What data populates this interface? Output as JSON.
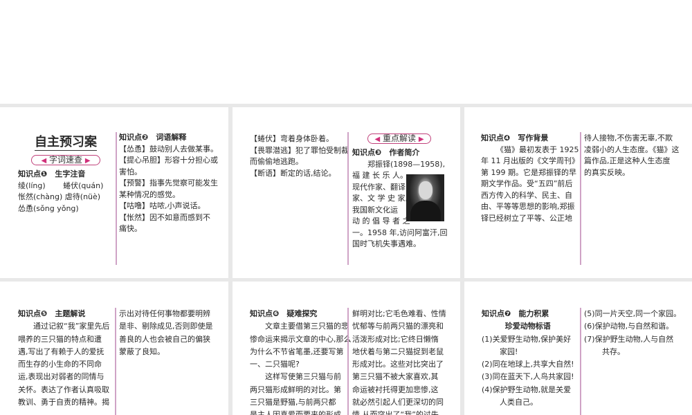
{
  "slides": [
    {
      "title": "自主预习案",
      "badge": "字词速查",
      "left": [
        {
          "t": "知识点❶　生字注音",
          "k": "h"
        },
        {
          "t": "绫(líng)　　 蜷伏(quán)"
        },
        {
          "t": "怅然(chàng)  虐待(nüè)"
        },
        {
          "t": "怂恿(sǒng yǒng)"
        }
      ],
      "right": [
        {
          "t": "知识点❷　词语解释",
          "k": "h"
        },
        {
          "t": "【怂恿】鼓动别人去做某事。"
        },
        {
          "t": "【提心吊胆】形容十分担心或"
        },
        {
          "t": "害怕。"
        },
        {
          "t": "【预警】指事先觉察可能发生"
        },
        {
          "t": "某种情况的感觉。"
        },
        {
          "t": "【咕噜】咕哝,小声说话。"
        },
        {
          "t": "【怅然】因不如意而感到不"
        },
        {
          "t": "痛快。"
        }
      ]
    },
    {
      "badge": "重点解读",
      "left": [
        {
          "t": "【蜷伏】弯着身体卧着。"
        },
        {
          "t": "【畏罪潜逃】犯了罪怕受制裁"
        },
        {
          "t": "而偷偷地逃跑。"
        },
        {
          "t": "【断语】断定的话,结论。"
        }
      ],
      "right": [
        {
          "t": "知识点❸　作者简介",
          "k": "h"
        },
        {
          "t": "郑振铎(1898—1958),",
          "k": "ind"
        },
        {
          "t": "福 建 长 乐 人。"
        },
        {
          "t": "现代作家、翻译"
        },
        {
          "t": "家、文 学 史 家,"
        },
        {
          "t": "我国新文化运"
        },
        {
          "t": "动 的 倡 导 者 之"
        },
        {
          "t": "一。1958 年,访问阿富汗,回"
        },
        {
          "t": "国时飞机失事遇难。"
        }
      ]
    },
    {
      "left": [
        {
          "t": "知识点❹　写作背景",
          "k": "h"
        },
        {
          "t": "《猫》最初发表于 1925",
          "k": "ind"
        },
        {
          "t": "年 11 月出版的《文学周刊》"
        },
        {
          "t": "第 199 期。它是郑振铎的早"
        },
        {
          "t": "期文学作品。受“五四”前后"
        },
        {
          "t": "西方传入的科学、民主、自"
        },
        {
          "t": "由、平等等思想的影响,郑振"
        },
        {
          "t": "铎已经树立了平等、公正地"
        }
      ],
      "right": [
        {
          "t": "待人接物,不伤害无辜,不欺"
        },
        {
          "t": "凌弱小的人生态度。《猫》这"
        },
        {
          "t": "篇作品,正是这种人生态度"
        },
        {
          "t": "的真实反映。"
        }
      ]
    },
    {
      "left": [
        {
          "t": "知识点❺　主题解说",
          "k": "h"
        },
        {
          "t": "通过记叙“我”家里先后",
          "k": "ind"
        },
        {
          "t": "喂养的三只猫的特点和遭"
        },
        {
          "t": "遇,写出了有赖于人的爱抚"
        },
        {
          "t": "而生存的小生命的不同命"
        },
        {
          "t": "运,表现出对弱者的同情与"
        },
        {
          "t": "关怀。表达了作者认真吸取"
        },
        {
          "t": "教训、勇于自责的精神。揭"
        }
      ],
      "right": [
        {
          "t": "示出对待任何事物都要明辨"
        },
        {
          "t": "是非、剔除成见,否则即使是"
        },
        {
          "t": "善良的人也会被自己的偏狭"
        },
        {
          "t": "蒙蔽了良知。"
        }
      ]
    },
    {
      "left": [
        {
          "t": "知识点❻　疑难探究",
          "k": "h"
        },
        {
          "t": "文章主要借第三只猫的悲",
          "k": "ind"
        },
        {
          "t": "惨命运来揭示文章的中心,那么"
        },
        {
          "t": "为什么不节省笔墨,还要写第"
        },
        {
          "t": "一、二只猫呢?"
        },
        {
          "t": "这样写使第三只猫与前",
          "k": "ind"
        },
        {
          "t": "两只猫形成鲜明的对比。第"
        },
        {
          "t": "三只猫是野猫,与前两只都"
        },
        {
          "t": "是主人因喜爱而要来的形成"
        }
      ],
      "right": [
        {
          "t": "鲜明对比;它毛色难看、性情"
        },
        {
          "t": "忧郁等与前两只猫的漂亮和"
        },
        {
          "t": "活泼形成对比;它终日懒惰"
        },
        {
          "t": "地伏着与第二只猫捉到老鼠"
        },
        {
          "t": "形成对比。这些对比突出了"
        },
        {
          "t": "第三只猫不被大家喜欢,其"
        },
        {
          "t": "命运被衬托得更加悲惨,这"
        },
        {
          "t": "就必然引起人们更深切的同"
        },
        {
          "t": "情,从而突出了“我”的过失"
        }
      ]
    },
    {
      "left": [
        {
          "t": "知识点❼　能力积累",
          "k": "h"
        },
        {
          "t": "珍爱动物标语",
          "k": "h c"
        },
        {
          "t": "(1)关爱野生动物,保护美好"
        },
        {
          "t": "家园!",
          "k": "ind2"
        },
        {
          "t": "(2)同在地球上,共享大自然!"
        },
        {
          "t": "(3)同在蓝天下,人鸟共家园!"
        },
        {
          "t": "(4)保护野生动物,就是关爱"
        },
        {
          "t": "人类自己。",
          "k": "ind2"
        }
      ],
      "right": [
        {
          "t": "(5)同一片天空,同一个家园。"
        },
        {
          "t": "(6)保护动物,与自然和谐。"
        },
        {
          "t": "(7)保护野生动物,人与自然"
        },
        {
          "t": "共存。",
          "k": "ind2"
        }
      ]
    }
  ]
}
